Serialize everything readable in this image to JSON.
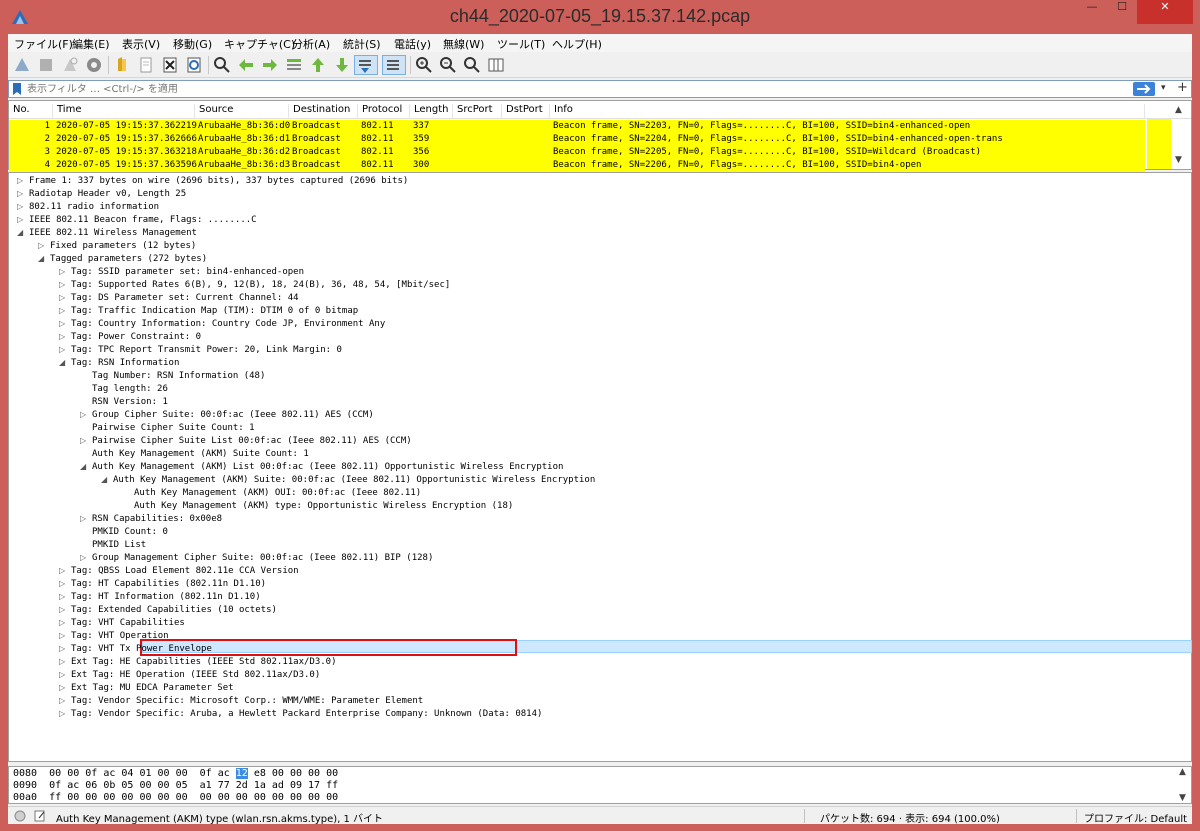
{
  "window": {
    "title": "ch44_2020-07-05_19.15.37.142.pcap",
    "minimize_glyph": "—",
    "maximize_glyph": "☐",
    "close_glyph": "✕"
  },
  "menu": [
    "ファイル(F)",
    "編集(E)",
    "表示(V)",
    "移動(G)",
    "キャプチャ(C)",
    "分析(A)",
    "統計(S)",
    "電話(y)",
    "無線(W)",
    "ツール(T)",
    "ヘルプ(H)"
  ],
  "toolbar_icons": [
    "shark-fin-start-icon",
    "stop-icon",
    "restart-icon",
    "options-gear-icon",
    "open-file-icon",
    "save-file-icon",
    "close-file-icon",
    "reload-icon",
    "find-icon",
    "back-icon",
    "forward-icon",
    "go-to-packet-icon",
    "first-packet-icon",
    "last-packet-icon",
    "autoscroll-icon",
    "colorize-icon",
    "zoom-in-icon",
    "zoom-out-icon",
    "zoom-reset-icon",
    "resize-columns-icon"
  ],
  "filter": {
    "placeholder": "表示フィルタ … <Ctrl-/> を適用",
    "dropdown_glyph": "▾",
    "plus_glyph": "+"
  },
  "packet_list": {
    "columns": [
      "No.",
      "Time",
      "Source",
      "Destination",
      "Protocol",
      "Length",
      "SrcPort",
      "DstPort",
      "Info"
    ],
    "rows": [
      {
        "no": "1",
        "time": "2020-07-05 19:15:37.362219",
        "source": "ArubaaHe_8b:36:d0",
        "destination": "Broadcast",
        "protocol": "802.11",
        "length": "337",
        "info": "Beacon frame, SN=2203, FN=0, Flags=........C, BI=100, SSID=bin4-enhanced-open"
      },
      {
        "no": "2",
        "time": "2020-07-05 19:15:37.362666",
        "source": "ArubaaHe_8b:36:d1",
        "destination": "Broadcast",
        "protocol": "802.11",
        "length": "359",
        "info": "Beacon frame, SN=2204, FN=0, Flags=........C, BI=100, SSID=bin4-enhanced-open-trans"
      },
      {
        "no": "3",
        "time": "2020-07-05 19:15:37.363218",
        "source": "ArubaaHe_8b:36:d2",
        "destination": "Broadcast",
        "protocol": "802.11",
        "length": "356",
        "info": "Beacon frame, SN=2205, FN=0, Flags=........C, BI=100, SSID=Wildcard (Broadcast)"
      },
      {
        "no": "4",
        "time": "2020-07-05 19:15:37.363596",
        "source": "ArubaaHe_8b:36:d3",
        "destination": "Broadcast",
        "protocol": "802.11",
        "length": "300",
        "info": "Beacon frame, SN=2206, FN=0, Flags=........C, BI=100, SSID=bin4-open"
      }
    ],
    "row_color": "#ffff00"
  },
  "tree": [
    {
      "arrow": "▷",
      "text": "Frame 1: 337 bytes on wire (2696 bits), 337 bytes captured (2696 bits)"
    },
    {
      "arrow": "▷",
      "text": "Radiotap Header v0, Length 25"
    },
    {
      "arrow": "▷",
      "text": "802.11 radio information"
    },
    {
      "arrow": "▷",
      "text": "IEEE 802.11 Beacon frame, Flags: ........C"
    },
    {
      "arrow": "◢",
      "text": "IEEE 802.11 Wireless Management"
    },
    {
      "arrow": "▷",
      "text": "Fixed parameters (12 bytes)"
    },
    {
      "arrow": "◢",
      "text": "Tagged parameters (272 bytes)"
    },
    {
      "arrow": "▷",
      "text": "Tag: SSID parameter set: bin4-enhanced-open"
    },
    {
      "arrow": "▷",
      "text": "Tag: Supported Rates 6(B), 9, 12(B), 18, 24(B), 36, 48, 54, [Mbit/sec]"
    },
    {
      "arrow": "▷",
      "text": "Tag: DS Parameter set: Current Channel: 44"
    },
    {
      "arrow": "▷",
      "text": "Tag: Traffic Indication Map (TIM): DTIM 0 of 0 bitmap"
    },
    {
      "arrow": "▷",
      "text": "Tag: Country Information: Country Code JP, Environment Any"
    },
    {
      "arrow": "▷",
      "text": "Tag: Power Constraint: 0"
    },
    {
      "arrow": "▷",
      "text": "Tag: TPC Report Transmit Power: 20, Link Margin: 0"
    },
    {
      "arrow": "◢",
      "text": "Tag: RSN Information"
    },
    {
      "arrow": "",
      "text": "Tag Number: RSN Information (48)"
    },
    {
      "arrow": "",
      "text": "Tag length: 26"
    },
    {
      "arrow": "",
      "text": "RSN Version: 1"
    },
    {
      "arrow": "▷",
      "text": "Group Cipher Suite: 00:0f:ac (Ieee 802.11) AES (CCM)"
    },
    {
      "arrow": "",
      "text": "Pairwise Cipher Suite Count: 1"
    },
    {
      "arrow": "▷",
      "text": "Pairwise Cipher Suite List 00:0f:ac (Ieee 802.11) AES (CCM)"
    },
    {
      "arrow": "",
      "text": "Auth Key Management (AKM) Suite Count: 1"
    },
    {
      "arrow": "◢",
      "text": "Auth Key Management (AKM) List 00:0f:ac (Ieee 802.11) Opportunistic Wireless Encryption"
    },
    {
      "arrow": "◢",
      "text": "Auth Key Management (AKM) Suite: 00:0f:ac (Ieee 802.11) Opportunistic Wireless Encryption"
    },
    {
      "arrow": "",
      "text": "Auth Key Management (AKM) OUI: 00:0f:ac (Ieee 802.11)"
    },
    {
      "arrow": "",
      "text": "Auth Key Management (AKM) type: Opportunistic Wireless Encryption (18)"
    },
    {
      "arrow": "▷",
      "text": "RSN Capabilities: 0x00e8"
    },
    {
      "arrow": "",
      "text": "PMKID Count: 0"
    },
    {
      "arrow": "",
      "text": "PMKID List"
    },
    {
      "arrow": "▷",
      "text": "Group Management Cipher Suite: 00:0f:ac (Ieee 802.11) BIP (128)"
    },
    {
      "arrow": "▷",
      "text": "Tag: QBSS Load Element 802.11e CCA Version"
    },
    {
      "arrow": "▷",
      "text": "Tag: HT Capabilities (802.11n D1.10)"
    },
    {
      "arrow": "▷",
      "text": "Tag: HT Information (802.11n D1.10)"
    },
    {
      "arrow": "▷",
      "text": "Tag: Extended Capabilities (10 octets)"
    },
    {
      "arrow": "▷",
      "text": "Tag: VHT Capabilities"
    },
    {
      "arrow": "▷",
      "text": "Tag: VHT Operation"
    },
    {
      "arrow": "▷",
      "text": "Tag: VHT Tx Power Envelope"
    },
    {
      "arrow": "▷",
      "text": "Ext Tag: HE Capabilities (IEEE Std 802.11ax/D3.0)"
    },
    {
      "arrow": "▷",
      "text": "Ext Tag: HE Operation (IEEE Std 802.11ax/D3.0)"
    },
    {
      "arrow": "▷",
      "text": "Ext Tag: MU EDCA Parameter Set"
    },
    {
      "arrow": "▷",
      "text": "Tag: Vendor Specific: Microsoft Corp.: WMM/WME: Parameter Element"
    },
    {
      "arrow": "▷",
      "text": "Tag: Vendor Specific: Aruba, a Hewlett Packard Enterprise Company: Unknown (Data: 0814)"
    }
  ],
  "selected_index": 25,
  "hex": {
    "rows": [
      {
        "offset": "0080",
        "before": "  00 00 0f ac 04 01 00 00  0f ac ",
        "hl": "12",
        "after": " e8 00 00 00 00"
      },
      {
        "offset": "0090",
        "before": "  0f ac 06 0b 05 00 00 05  a1 77 2d 1a ad 09 17 ff",
        "hl": "",
        "after": ""
      },
      {
        "offset": "00a0",
        "before": "  ff 00 00 00 00 00 00 00  00 00 00 00 00 00 00 00",
        "hl": "",
        "after": ""
      }
    ]
  },
  "status": {
    "field_info": "Auth Key Management (AKM) type (wlan.rsn.akms.type), 1 バイト",
    "packets": "パケット数: 694 · 表示: 694 (100.0%)",
    "profile": "プロファイル: Default"
  }
}
